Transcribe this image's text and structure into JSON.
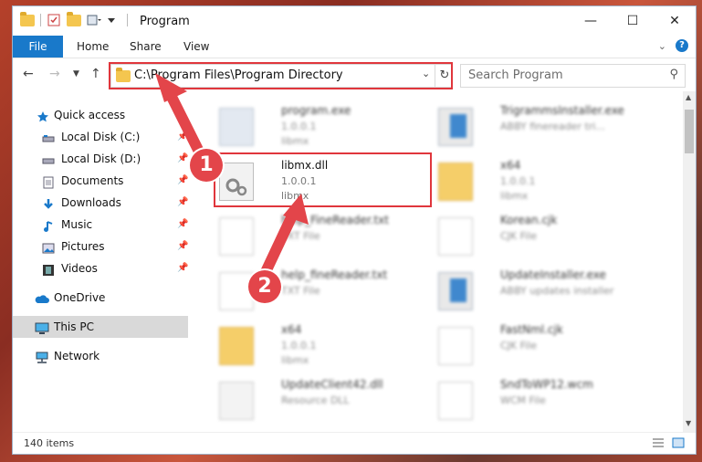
{
  "window": {
    "title": "Program"
  },
  "ribbon": {
    "file": "File",
    "tabs": [
      "Home",
      "Share",
      "View"
    ]
  },
  "address": {
    "path": "C:\\Program Files\\Program Directory"
  },
  "search": {
    "placeholder": "Search Program"
  },
  "sidebar": {
    "items": [
      {
        "label": "Quick access",
        "icon": "star-icon"
      },
      {
        "label": "Local Disk (C:)",
        "icon": "drive-icon",
        "pinned": true
      },
      {
        "label": "Local Disk (D:)",
        "icon": "drive-icon",
        "pinned": true
      },
      {
        "label": "Documents",
        "icon": "documents-icon",
        "pinned": true
      },
      {
        "label": "Downloads",
        "icon": "download-icon",
        "pinned": true
      },
      {
        "label": "Music",
        "icon": "music-icon",
        "pinned": true
      },
      {
        "label": "Pictures",
        "icon": "pictures-icon",
        "pinned": true
      },
      {
        "label": "Videos",
        "icon": "videos-icon",
        "pinned": true
      },
      {
        "label": "OneDrive",
        "icon": "cloud-icon"
      },
      {
        "label": "This PC",
        "icon": "pc-icon",
        "selected": true
      },
      {
        "label": "Network",
        "icon": "network-icon"
      }
    ]
  },
  "files": [
    {
      "name": "program.exe",
      "line1": "1.0.0.1",
      "line2": "libmx",
      "type": "exe"
    },
    {
      "name": "TrigrammsInstaller.exe",
      "line1": "ABBY finereader tri...",
      "line2": "",
      "type": "exe2"
    },
    {
      "name": "libmx.dll",
      "line1": "1.0.0.1",
      "line2": "libmx",
      "type": "dll",
      "highlighted": true
    },
    {
      "name": "x64",
      "line1": "1.0.0.1",
      "line2": "libmx",
      "type": "folder"
    },
    {
      "name": "help_FineReader.txt",
      "line1": "TXT File",
      "line2": "",
      "type": "doc"
    },
    {
      "name": "Korean.cjk",
      "line1": "CJK File",
      "line2": "",
      "type": "doc"
    },
    {
      "name": "help_fineReader.txt",
      "line1": "TXT File",
      "line2": "",
      "type": "doc"
    },
    {
      "name": "UpdateInstaller.exe",
      "line1": "ABBY updates installer",
      "line2": "",
      "type": "exe2"
    },
    {
      "name": "x64",
      "line1": "1.0.0.1",
      "line2": "libmx",
      "type": "folder"
    },
    {
      "name": "FastNml.cjk",
      "line1": "CJK File",
      "line2": "",
      "type": "doc"
    },
    {
      "name": "UpdateClient42.dll",
      "line1": "Resource DLL",
      "line2": "",
      "type": "dll"
    },
    {
      "name": "SndToWP12.wcm",
      "line1": "WCM File",
      "line2": "",
      "type": "doc"
    }
  ],
  "status": {
    "count": "140 items"
  },
  "annotations": {
    "step1": "1",
    "step2": "2"
  },
  "colors": {
    "accent": "#1979ca",
    "highlight": "#e0363c"
  }
}
